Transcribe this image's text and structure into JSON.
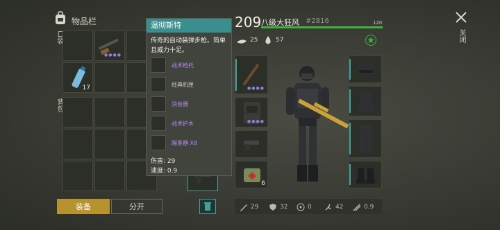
{
  "inventory": {
    "title": "物品栏",
    "pocket_label": "口袋",
    "backpack_label": "背包",
    "water_count": "17"
  },
  "tooltip": {
    "title": "温彻斯特",
    "description": "传奇的自动装弹步枪。简单且威力十足。",
    "mods": [
      {
        "label": "战术枪托",
        "color": "#b48cf0"
      },
      {
        "label": "经典机匣",
        "color": "#c8c8bc"
      },
      {
        "label": "消音器",
        "color": "#b48cf0"
      },
      {
        "label": "战术护木",
        "color": "#b48cf0"
      },
      {
        "label": "瞄准器 X8",
        "color": "#b48cf0"
      }
    ],
    "damage": "伤害: 29",
    "speed": "速度: 0.9"
  },
  "player": {
    "level": "209",
    "name": "八级大狂风",
    "id": "#2816",
    "xp": "120",
    "food": "25",
    "water": "57"
  },
  "buttons": {
    "equip": "装备",
    "split": "分开",
    "close_label": "关闭"
  },
  "medkit_count": "6",
  "stats": {
    "attack": "29",
    "defense": "32",
    "radiation": "0",
    "speed": "42",
    "rate": "0.9"
  },
  "colors": {
    "accent": "#3ea3a0",
    "equip_button": "#b8922e",
    "xp_bar": "#3fb340"
  }
}
